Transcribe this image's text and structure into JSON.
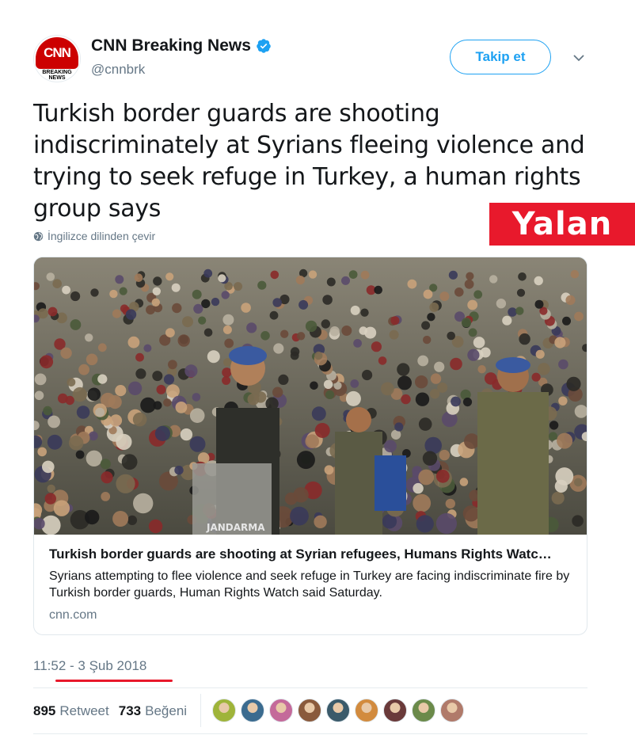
{
  "header": {
    "name": "CNN Breaking News",
    "handle": "@cnnbrk",
    "avatar_logo_text": "CNN",
    "avatar_sub_line1": "BREAKING",
    "avatar_sub_line2": "NEWS",
    "follow_label": "Takip et"
  },
  "tweet": {
    "text": "Turkish border guards are shooting indiscriminately at Syrians fleeing violence and trying to seek refuge in Turkey, a human rights group says",
    "translate_label": "İngilizce dilinden çevir"
  },
  "overlay": {
    "label": "Yalan"
  },
  "card": {
    "image_watermark": "JANDARMA",
    "title": "Turkish border guards are shooting at Syrian refugees, Humans Rights Watc…",
    "description": "Syrians attempting to flee violence and seek refuge in Turkey are facing indiscriminate fire by Turkish border guards, Human Rights Watch said Saturday.",
    "domain": "cnn.com"
  },
  "meta": {
    "timestamp": "11:52 - 3 Şub 2018"
  },
  "stats": {
    "retweet_count": "895",
    "retweet_label": "Retweet",
    "like_count": "733",
    "like_label": "Beğeni"
  },
  "liker_avatars": [
    {
      "color": "#9fb43a"
    },
    {
      "color": "#3b6b8f"
    },
    {
      "color": "#c46a9a"
    },
    {
      "color": "#8a5a3c"
    },
    {
      "color": "#3a5a6a"
    },
    {
      "color": "#d28b3e"
    },
    {
      "color": "#6a3a3a"
    },
    {
      "color": "#6b8a4a"
    },
    {
      "color": "#b07a6a"
    }
  ],
  "colors": {
    "brand_blue": "#1da1f2",
    "overlay_red": "#e8192c",
    "cnn_red": "#cc0000"
  }
}
